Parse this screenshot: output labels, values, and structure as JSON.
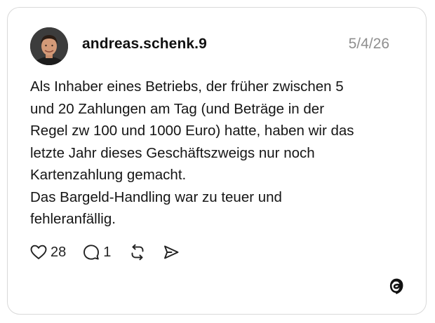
{
  "post": {
    "username": "andreas.schenk.9",
    "date": "5/4/26",
    "lines": [
      "Als Inhaber eines Betriebs, der früher zwischen 5",
      "und 20 Zahlungen am Tag (und Beträge in der",
      "Regel zw 100 und 1000 Euro) hatte, haben wir das",
      "letzte Jahr dieses Geschäftszweigs nur noch",
      "Kartenzahlung gemacht.",
      "Das Bargeld-Handling war zu teuer und",
      "fehleranfällig."
    ]
  },
  "actions": {
    "like_icon": "heart-icon",
    "like_count": "28",
    "reply_icon": "speech-bubble-icon",
    "reply_count": "1",
    "repost_icon": "repost-icon",
    "share_icon": "send-icon"
  },
  "brand": {
    "icon": "threads-logo-icon"
  },
  "colors": {
    "text": "#151515",
    "muted": "#8f8f8f",
    "border": "#d9d9d9"
  }
}
